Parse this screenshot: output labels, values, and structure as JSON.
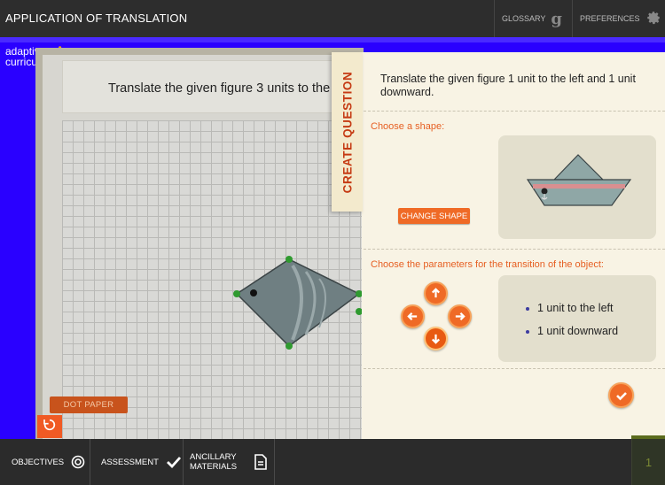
{
  "header": {
    "title": "APPLICATION OF TRANSLATION",
    "glossary_label": "GLOSSARY",
    "preferences_label": "PREFERENCES"
  },
  "logo": {
    "line1": "adaptive",
    "line2": "curriculum"
  },
  "board": {
    "prompt": "Translate the given figure 3 units to the",
    "dot_paper_label": "DOT PAPER"
  },
  "panel": {
    "tab_label": "CREATE QUESTION",
    "question": "Translate the given figure 1 unit to the left and 1 unit downward.",
    "choose_shape_label": "Choose a shape:",
    "change_shape_label": "CHANGE SHAPE",
    "choose_params_label": "Choose the parameters for the transition of the object:",
    "params": [
      "1 unit to the left",
      "1 unit downward"
    ]
  },
  "bottom": {
    "objectives_label": "OBJECTIVES",
    "assessment_label": "ASSESSMENT",
    "ancillary_line1": "ANCILLARY",
    "ancillary_line2": "MATERIALS",
    "page_number": "1"
  },
  "colors": {
    "accent": "#ef6a26",
    "frame_blue": "#2a00ff",
    "tab_text": "#c53a13"
  },
  "icons": [
    "glossary-g-icon",
    "gear-icon",
    "reset-icon",
    "arrow-up-icon",
    "arrow-left-icon",
    "arrow-right-icon",
    "arrow-down-icon",
    "check-icon",
    "target-icon",
    "document-icon"
  ]
}
